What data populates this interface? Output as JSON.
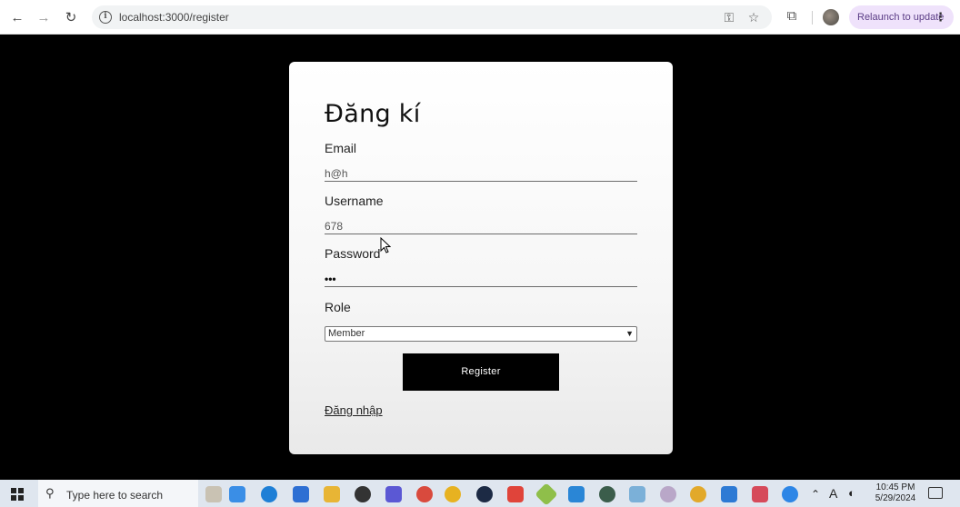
{
  "browser": {
    "back_icon": "arrow-left-icon",
    "forward_icon": "arrow-right-icon",
    "reload_icon": "reload-icon",
    "url": "localhost:3000/register",
    "relaunch_label": "Relaunch to update"
  },
  "form": {
    "title": "Đăng kí",
    "email_label": "Email",
    "email_value": "h@h",
    "username_label": "Username",
    "username_value": "678",
    "password_label": "Password",
    "password_value": "•••",
    "role_label": "Role",
    "role_selected": "Member",
    "register_label": "Register",
    "login_link": "Đăng nhập"
  },
  "taskbar": {
    "search_placeholder": "Type here to search",
    "time": "10:45 PM",
    "date": "5/29/2024",
    "lang": "A"
  },
  "colors": {
    "page_bg": "#000000",
    "card_bg": "#ffffff",
    "button_bg": "#000000",
    "relaunch_bg": "#efe2fb"
  }
}
